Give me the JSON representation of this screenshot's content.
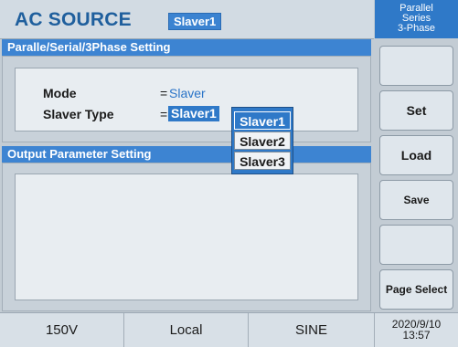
{
  "header": {
    "title": "AC SOURCE",
    "badge": "Slaver1",
    "mode_lines": [
      "Parallel",
      "Series",
      "3-Phase"
    ]
  },
  "sections": {
    "parallel": {
      "title": "Paralle/Serial/3Phase  Setting",
      "mode_label": "Mode",
      "mode_eq": "=",
      "mode_value": "Slaver",
      "slaver_type_label": "Slaver  Type",
      "slaver_type_eq": "=",
      "slaver_type_value": "Slaver1"
    },
    "output": {
      "title": "Output Parameter  Setting"
    }
  },
  "dropdown": {
    "options": [
      "Slaver1",
      "Slaver2",
      "Slaver3"
    ],
    "selected_index": 0
  },
  "softkeys": {
    "k1": "",
    "k2": "Set",
    "k3": "Load",
    "k4": "Save",
    "k5": "",
    "k6": "Page Select"
  },
  "status": {
    "voltage": "150V",
    "control": "Local",
    "waveform": "SINE",
    "date": "2020/9/10",
    "time": "13:57"
  },
  "colors": {
    "accent_blue": "#2f79c8",
    "title_blue": "#1f5f9d",
    "panel_bg": "#e8edf1"
  }
}
